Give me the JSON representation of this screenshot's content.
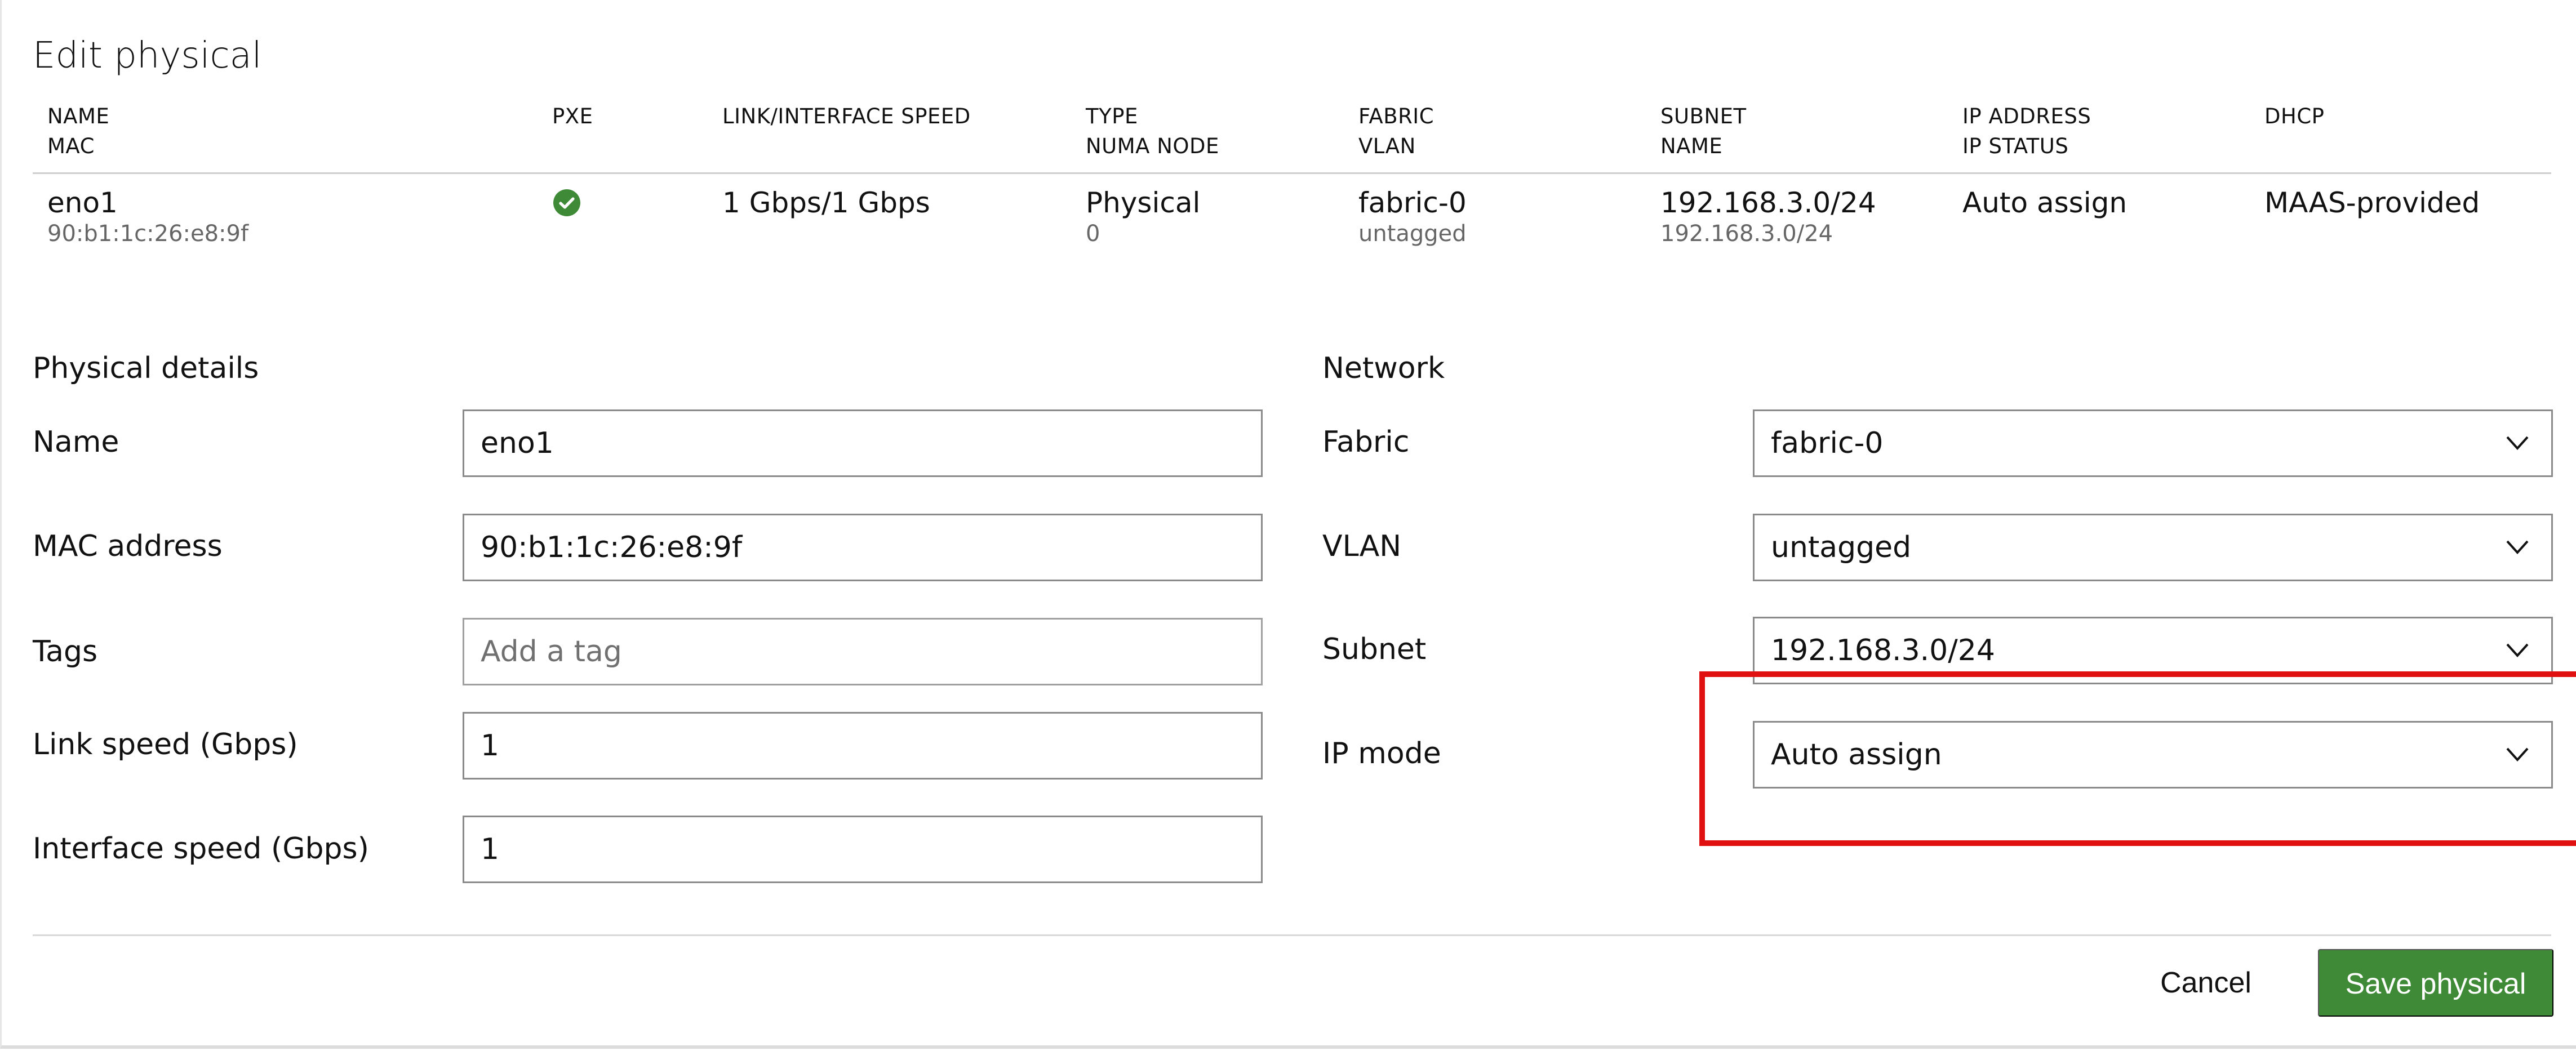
{
  "title": "Edit physical",
  "table": {
    "headers": {
      "name": "NAME",
      "mac": "MAC",
      "pxe": "PXE",
      "speed": "LINK/INTERFACE SPEED",
      "type": "TYPE",
      "numa": "NUMA NODE",
      "fabric": "FABRIC",
      "vlan": "VLAN",
      "subnet": "SUBNET",
      "subnet_name": "NAME",
      "ip": "IP ADDRESS",
      "ip_status": "IP STATUS",
      "dhcp": "DHCP"
    },
    "row": {
      "name": "eno1",
      "mac": "90:b1:1c:26:e8:9f",
      "pxe_icon": "check-circle-icon",
      "speed": "1 Gbps/1 Gbps",
      "type": "Physical",
      "numa": "0",
      "fabric": "fabric-0",
      "vlan": "untagged",
      "subnet": "192.168.3.0/24",
      "subnet_name": "192.168.3.0/24",
      "ip": "Auto assign",
      "dhcp": "MAAS-provided"
    }
  },
  "physical_details": {
    "title": "Physical details",
    "name_label": "Name",
    "name_value": "eno1",
    "mac_label": "MAC address",
    "mac_value": "90:b1:1c:26:e8:9f",
    "tags_label": "Tags",
    "tags_placeholder": "Add a tag",
    "link_speed_label": "Link speed (Gbps)",
    "link_speed_value": "1",
    "interface_speed_label": "Interface speed (Gbps)",
    "interface_speed_value": "1"
  },
  "network": {
    "title": "Network",
    "fabric_label": "Fabric",
    "fabric_value": "fabric-0",
    "vlan_label": "VLAN",
    "vlan_value": "untagged",
    "subnet_label": "Subnet",
    "subnet_value": "192.168.3.0/24",
    "ip_mode_label": "IP mode",
    "ip_mode_value": "Auto assign",
    "dropdown_icon": "chevron-down-icon"
  },
  "footer": {
    "cancel_label": "Cancel",
    "save_label": "Save physical"
  },
  "colors": {
    "accent_green": "#3f8a36",
    "highlight_red": "#e01010"
  }
}
